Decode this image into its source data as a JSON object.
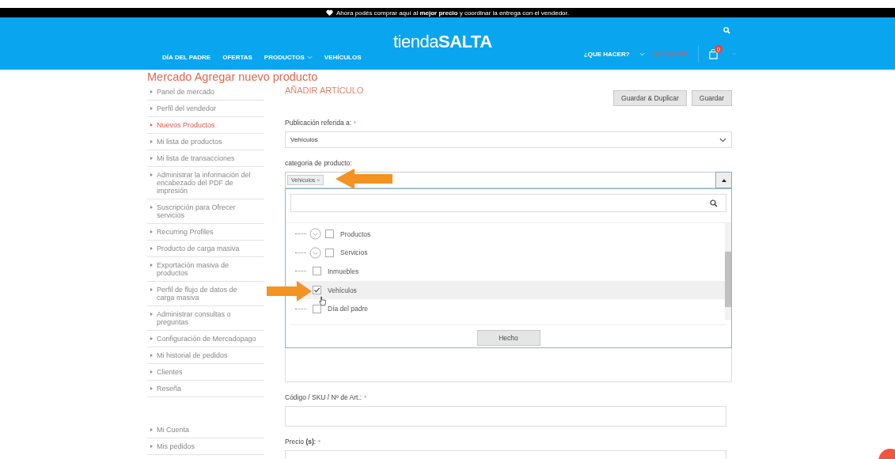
{
  "promo_bar": {
    "text": "Ahora podés comprar aquí al **mejor precio** y coordinar la entrega con el vendedor."
  },
  "header": {
    "logo_light": "tienda",
    "logo_bold": "SALTA",
    "nav": [
      {
        "label": "DÍA DEL PADRE",
        "dropdown": false
      },
      {
        "label": "OFERTAS",
        "dropdown": false
      },
      {
        "label": "PRODUCTOS",
        "dropdown": true
      },
      {
        "label": "VEHÍCULOS",
        "dropdown": false
      }
    ],
    "que_hacer": "¿QUE HACER?",
    "mi_cuenta": "MI CUENTA",
    "cart_count": "0"
  },
  "page_title": "Mercado Agregar nuevo producto",
  "sidebar": {
    "items": [
      {
        "label": "Panel de mercado",
        "selected": false
      },
      {
        "label": "Perfil del vendedor",
        "selected": false
      },
      {
        "label": "Nuevos Productos",
        "selected": true
      },
      {
        "label": "Mi lista de productos",
        "selected": false
      },
      {
        "label": "Mi lista de transacciones",
        "selected": false
      },
      {
        "label": "Administrar la información del encabezado del PDF de impresión",
        "selected": false
      },
      {
        "label": "Suscripción para Ofrecer servicios",
        "selected": false
      },
      {
        "label": "Recurring Profiles",
        "selected": false
      },
      {
        "label": "Producto de carga masiva",
        "selected": false
      },
      {
        "label": "Exportación masiva de productos",
        "selected": false
      },
      {
        "label": "Perfil de flujo de datos de carga masiva",
        "selected": false
      },
      {
        "label": "Administrar consultas o preguntas",
        "selected": false
      },
      {
        "label": "Configuración de Mercadopago",
        "selected": false
      },
      {
        "label": "Mi historial de pedidos",
        "selected": false
      },
      {
        "label": "Clientes",
        "selected": false
      },
      {
        "label": "Reseña",
        "selected": false
      }
    ],
    "account_items": [
      {
        "label": "Mi Cuenta",
        "selected": false
      },
      {
        "label": "Mis pedidos",
        "selected": false
      }
    ]
  },
  "form": {
    "heading": "AÑADIR ARTÍCULO",
    "buttons": [
      "Guardar & Duplicar",
      "Guardar"
    ],
    "publication": {
      "label": "Publicación referida a:",
      "required_mark": "*",
      "value": "Vehículos"
    },
    "category": {
      "label": "categoria de producto:",
      "tags": [
        {
          "label": "Vehículos",
          "remove": "×"
        }
      ],
      "expanded": true,
      "tree": [
        {
          "label": "Productos",
          "kind": "collapsible",
          "checked": false,
          "selected": false
        },
        {
          "label": "Servicios",
          "kind": "collapsible",
          "checked": false,
          "selected": false
        },
        {
          "label": "Inmuebles",
          "kind": "leaf",
          "checked": false,
          "selected": false
        },
        {
          "label": "Vehículos",
          "kind": "leaf",
          "checked": true,
          "selected": true
        },
        {
          "label": "Día del padre",
          "kind": "leaf",
          "checked": false,
          "selected": false
        }
      ],
      "done_button": "Hecho"
    },
    "sku": {
      "label": "Código / SKU / Nº de Art.:",
      "required_mark": "*"
    },
    "price": {
      "label": "Precio **(s)**:",
      "required_mark": "*"
    }
  }
}
